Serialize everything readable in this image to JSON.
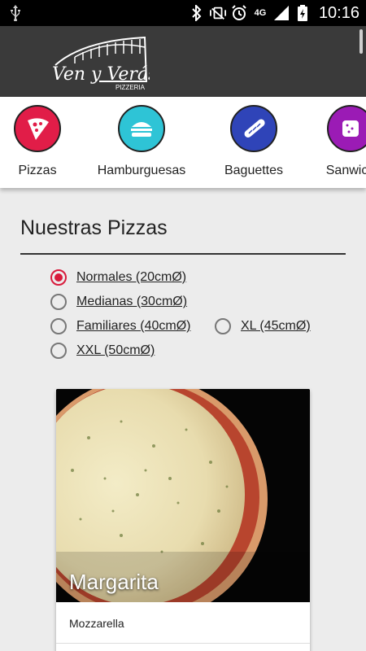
{
  "status_bar": {
    "network": "4G",
    "time": "10:16"
  },
  "header": {
    "logo_text": "Ven y Verás",
    "logo_subtext": "PIZZERIA"
  },
  "categories": [
    {
      "label": "Pizzas",
      "color": "#e11d48",
      "icon": "pizza-slice-icon"
    },
    {
      "label": "Hamburguesas",
      "color": "#2ec4d6",
      "icon": "burger-icon"
    },
    {
      "label": "Baguettes",
      "color": "#2f44b8",
      "icon": "baguette-icon"
    },
    {
      "label": "Sanwich",
      "color": "#9b1bb5",
      "icon": "sandwich-icon"
    }
  ],
  "section": {
    "title": "Nuestras Pizzas"
  },
  "sizes": [
    {
      "label": "Normales (20cmØ)",
      "selected": true
    },
    {
      "label": "Medianas (30cmØ)",
      "selected": false
    },
    {
      "label": "Familiares (40cmØ)",
      "selected": false
    },
    {
      "label": "XL (45cmØ)",
      "selected": false
    },
    {
      "label": "XXL (50cmØ)",
      "selected": false
    }
  ],
  "product": {
    "name": "Margarita",
    "description": "Mozzarella"
  },
  "colors": {
    "accent": "#d81b3c",
    "header_bg": "#3a3a3a"
  }
}
